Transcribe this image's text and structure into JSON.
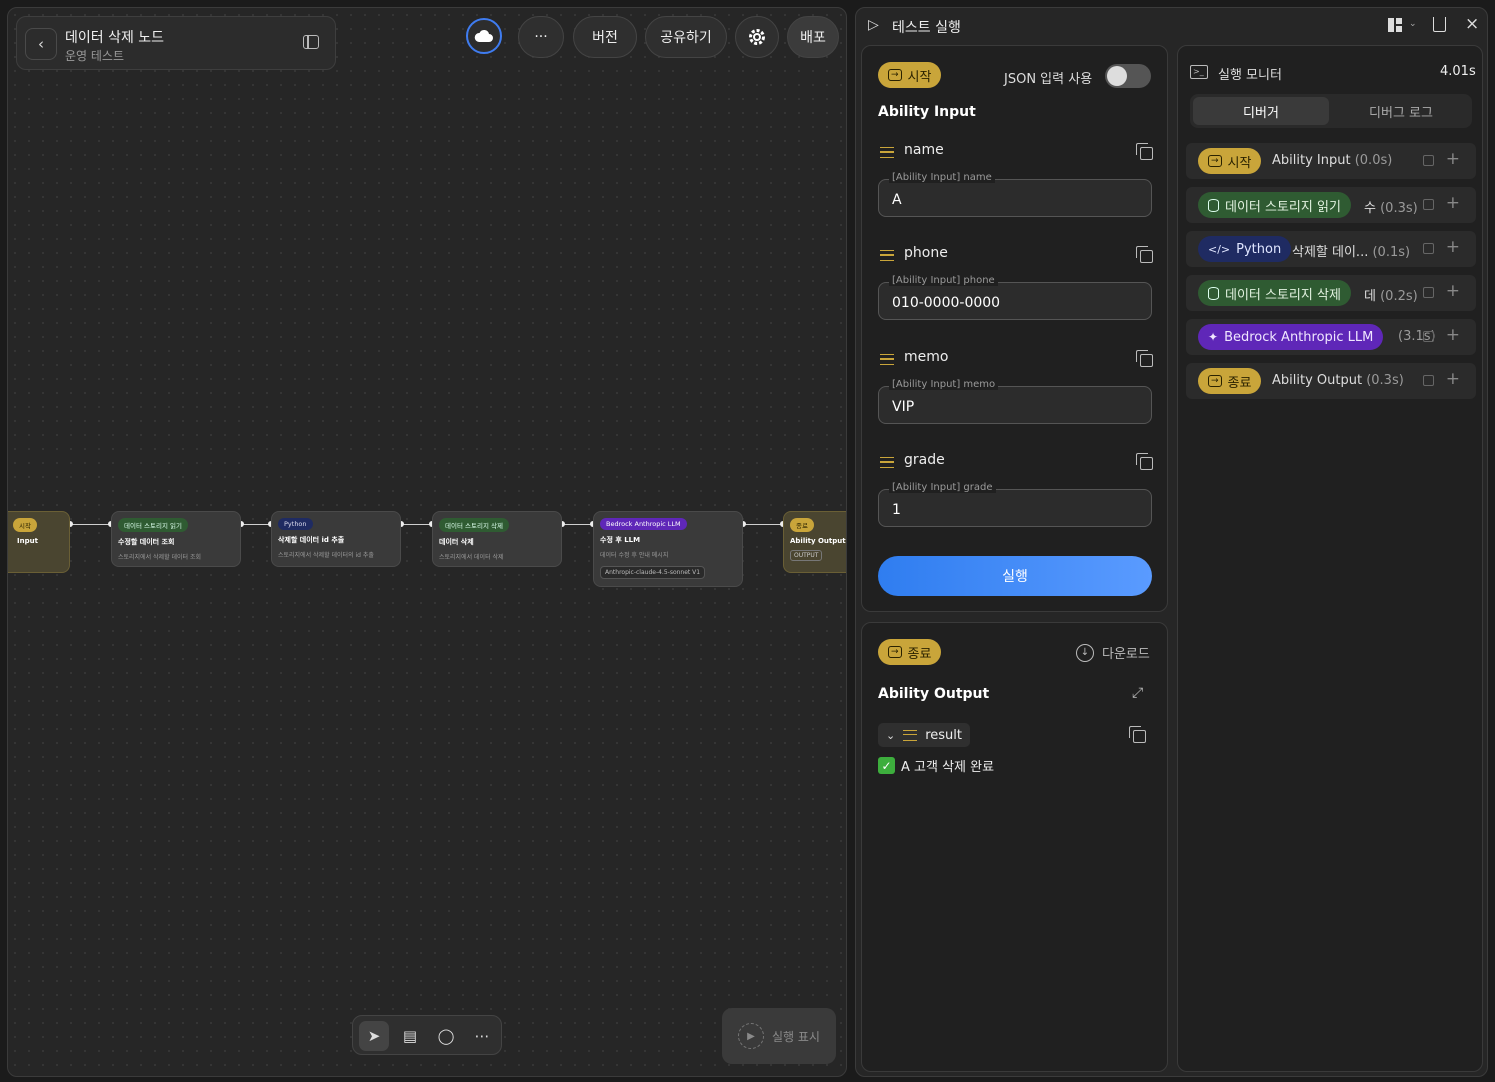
{
  "header": {
    "title": "데이터 삭제 노드",
    "subtitle": "운영 테스트"
  },
  "topbar": {
    "more_label": "···",
    "version_label": "버전",
    "share_label": "공유하기",
    "deploy_label": "배포"
  },
  "flow": {
    "nodes": [
      {
        "tag": "시작",
        "title": "Input",
        "desc": "",
        "extra": ""
      },
      {
        "tag": "데이터 스토리지 읽기",
        "title": "수정할 데이터 조회",
        "desc": "스토리지에서 삭제할 데이터 조회",
        "extra": ""
      },
      {
        "tag": "Python",
        "title": "삭제할 데이터 id 추출",
        "desc": "스토리지에서 삭제할 데이터의 id 추출",
        "extra": ""
      },
      {
        "tag": "데이터 스토리지 삭제",
        "title": "데이터 삭제",
        "desc": "스토리지에서 데이터 삭제",
        "extra": ""
      },
      {
        "tag": "Bedrock Anthropic LLM",
        "title": "수정 후 LLM",
        "desc": "데이터 수정 후 안내 메시지",
        "extra": "Anthropic-claude-4.5-sonnet V1"
      },
      {
        "tag": "종료",
        "title": "Ability Output",
        "desc": "",
        "extra": "OUTPUT"
      }
    ]
  },
  "canvas_toolbar": {
    "run_show_label": "실행 표시"
  },
  "test_panel": {
    "title": "테스트 실행",
    "start_badge": "시작",
    "json_toggle_label": "JSON 입력 사용",
    "section_title": "Ability Input",
    "fields": [
      {
        "label": "name",
        "legend": "[Ability Input] name",
        "value": "A"
      },
      {
        "label": "phone",
        "legend": "[Ability Input] phone",
        "value": "010-0000-0000"
      },
      {
        "label": "memo",
        "legend": "[Ability Input] memo",
        "value": "VIP"
      },
      {
        "label": "grade",
        "legend": "[Ability Input] grade",
        "value": "1"
      }
    ],
    "run_label": "실행"
  },
  "output_panel": {
    "end_badge": "종료",
    "download_label": "다운로드",
    "section_title": "Ability Output",
    "result_key": "result",
    "result_value": "A 고객 삭제 완료"
  },
  "monitor": {
    "title": "실행 모니터",
    "time": "4.01s",
    "tabs": [
      "디버거",
      "디버그 로그"
    ],
    "rows": [
      {
        "badge": "시작",
        "text": "Ability Input",
        "time": "(0.0s)",
        "style": "gold"
      },
      {
        "badge": "데이터 스토리지 읽기",
        "text": "수",
        "time": "(0.3s)",
        "style": "green"
      },
      {
        "badge": "Python",
        "text": "삭제할 데이...",
        "time": "(0.1s)",
        "style": "navy"
      },
      {
        "badge": "데이터 스토리지 삭제",
        "text": "데",
        "time": "(0.2s)",
        "style": "green"
      },
      {
        "badge": "Bedrock Anthropic LLM",
        "text": "",
        "time": "(3.1s)",
        "style": "purple"
      },
      {
        "badge": "종료",
        "text": "Ability Output",
        "time": "(0.3s)",
        "style": "gold"
      }
    ]
  }
}
